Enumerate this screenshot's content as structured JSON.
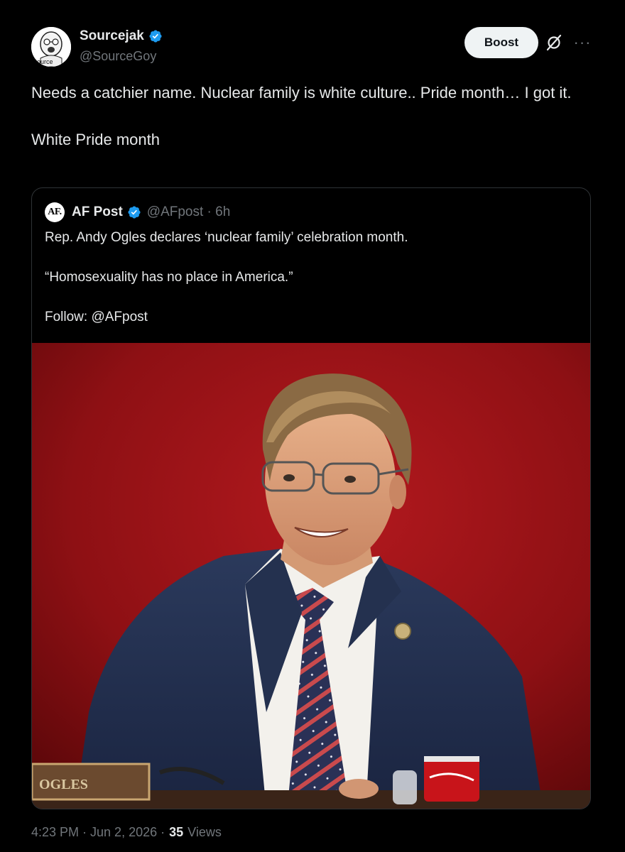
{
  "author": {
    "display_name": "Sourcejak",
    "handle": "@SourceGoy",
    "avatar_label": "Source"
  },
  "actions": {
    "boost_label": "Boost",
    "grok_icon": "grok-icon",
    "more_icon": "more-icon"
  },
  "tweet": {
    "line1": "Needs a catchier name. Nuclear family is white culture.. Pride month… I got it.",
    "line2": "White Pride month"
  },
  "quote": {
    "avatar_text": "AF.",
    "display_name": "AF Post",
    "handle_time": "@AFpost · 6h",
    "line1": "Rep. Andy Ogles declares ‘nuclear family’ celebration month.",
    "line2": "“Homosexuality has no place in America.”",
    "line3": "Follow: @AFpost",
    "photo_nameplate": "OGLES"
  },
  "meta": {
    "timestamp": "4:23 PM · Jun 2, 2026 ·",
    "views_count": "35",
    "views_label": "Views"
  },
  "colors": {
    "background": "#000000",
    "text": "#e7e9ea",
    "muted": "#71767b",
    "verified": "#1d9bf0",
    "border": "#2f3336"
  }
}
